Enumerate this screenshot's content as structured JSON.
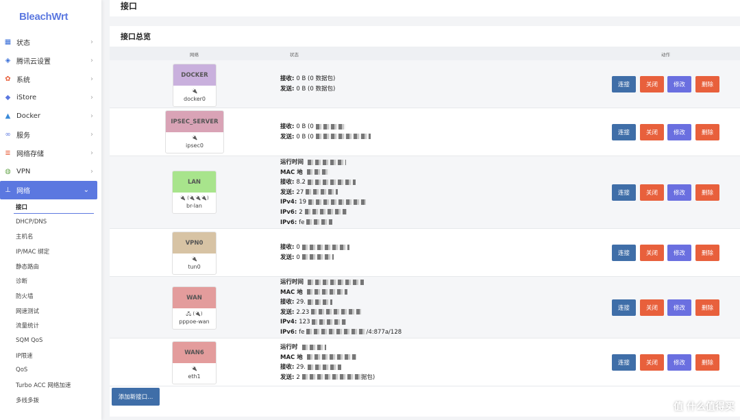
{
  "logo": "BleachWrt",
  "nav": [
    {
      "label": "状态",
      "icon": "grid-icon",
      "color": "#3a6fd8"
    },
    {
      "label": "腾讯云设置",
      "icon": "cube-icon",
      "color": "#3a6fd8"
    },
    {
      "label": "系统",
      "icon": "gear-icon",
      "color": "#e8603c"
    },
    {
      "label": "iStore",
      "icon": "store-icon",
      "color": "#5b78e0"
    },
    {
      "label": "Docker",
      "icon": "docker-icon",
      "color": "#3a8ad8"
    },
    {
      "label": "服务",
      "icon": "link-icon",
      "color": "#5b78e0"
    },
    {
      "label": "网络存储",
      "icon": "database-icon",
      "color": "#e8603c"
    },
    {
      "label": "VPN",
      "icon": "globe-icon",
      "color": "#6aa84f"
    },
    {
      "label": "网络",
      "icon": "network-icon",
      "color": "#ffffff"
    }
  ],
  "subnav": [
    "接口",
    "DHCP/DNS",
    "主机名",
    "IP/MAC 绑定",
    "静态路由",
    "诊断",
    "防火墙",
    "网速测试",
    "流量统计",
    "SQM QoS",
    "IP限速",
    "QoS",
    "Turbo ACC 网络加速",
    "多线多拨"
  ],
  "page_title": "接口",
  "panel_title": "接口总览",
  "table_headers": {
    "network": "网络",
    "status": "状态",
    "actions": "动作"
  },
  "buttons": {
    "connect": "连接",
    "close": "关闭",
    "edit": "修改",
    "delete": "删除",
    "add": "添加新接口..."
  },
  "interfaces": [
    {
      "name": "DOCKER",
      "device": "docker0",
      "dev_icons": "🔌",
      "color": "#c9b0dd",
      "status": [
        [
          "接收:",
          "0 B (0 数据包)"
        ],
        [
          "发送:",
          "0 B (0 数据包)"
        ]
      ]
    },
    {
      "name": "IPSEC_SERVER",
      "device": "ipsec0",
      "dev_icons": "🔌",
      "color": "#d9a3b6",
      "status": [
        [
          "接收:",
          "0 B (0"
        ],
        [
          "发送:",
          "0 B (0"
        ]
      ]
    },
    {
      "name": "LAN",
      "device": "br-lan",
      "dev_icons": "🔌 (🔌🔌🔌)",
      "color": "#a8e48c",
      "status": [
        [
          "运行时间",
          ""
        ],
        [
          "MAC 地",
          ""
        ],
        [
          "接收:",
          "8.2"
        ],
        [
          "发送:",
          "27"
        ],
        [
          "IPv4:",
          "19"
        ],
        [
          "IPv6:",
          "2"
        ],
        [
          "IPv6:",
          "fe"
        ]
      ]
    },
    {
      "name": "VPN0",
      "device": "tun0",
      "dev_icons": "🔌",
      "color": "#d7c3a4",
      "status": [
        [
          "接收:",
          "0"
        ],
        [
          "发送:",
          "0"
        ]
      ]
    },
    {
      "name": "WAN",
      "device": "pppoe-wan",
      "dev_icons": "🖧 (🔌)",
      "color": "#e39c9c",
      "status": [
        [
          "运行时间",
          ""
        ],
        [
          "MAC 地",
          ""
        ],
        [
          "接收:",
          "29."
        ],
        [
          "发送:",
          "2.23"
        ],
        [
          "IPv4:",
          "123"
        ],
        [
          "IPv6:",
          "fe"
        ]
      ],
      "tail": "/4:877a/128"
    },
    {
      "name": "WAN6",
      "device": "eth1",
      "dev_icons": "🔌",
      "color": "#e39c9c",
      "status": [
        [
          "运行时",
          ""
        ],
        [
          "MAC 地",
          ""
        ],
        [
          "接收:",
          "29."
        ],
        [
          "发送:",
          "2"
        ]
      ],
      "tail2": "据包)"
    }
  ],
  "watermark": "值 什么值得买"
}
